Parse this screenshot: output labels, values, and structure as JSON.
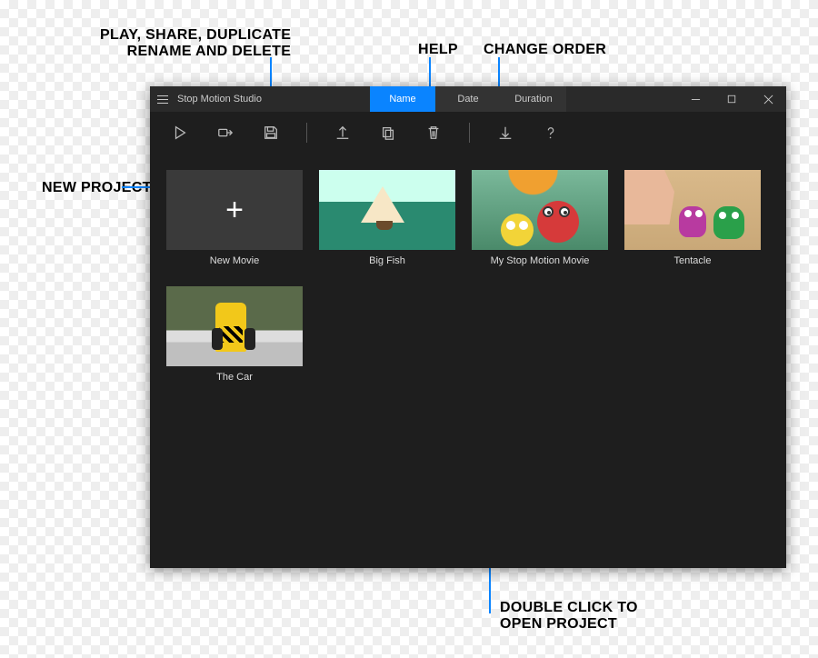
{
  "annotations": {
    "toolbar_group": "PLAY, SHARE, DUPLICATE\nRENAME AND DELETE",
    "help": "HELP",
    "change_order": "CHANGE ORDER",
    "new_project": "NEW PROJECT",
    "double_click": "DOUBLE CLICK TO\nOPEN PROJECT"
  },
  "window": {
    "app_title": "Stop Motion Studio",
    "sort_tabs": {
      "name": "Name",
      "date": "Date",
      "duration": "Duration",
      "active": "name"
    },
    "toolbar": {
      "play": "Play",
      "share": "Share",
      "save": "Save",
      "export": "Export",
      "duplicate": "Duplicate",
      "delete": "Delete",
      "import": "Import",
      "help": "Help"
    },
    "projects": [
      {
        "label": "New Movie",
        "type": "new"
      },
      {
        "label": "Big Fish",
        "type": "bigfish"
      },
      {
        "label": "My Stop Motion Movie",
        "type": "stopmotion"
      },
      {
        "label": "Tentacle",
        "type": "tentacle"
      },
      {
        "label": "The Car",
        "type": "car"
      }
    ]
  }
}
